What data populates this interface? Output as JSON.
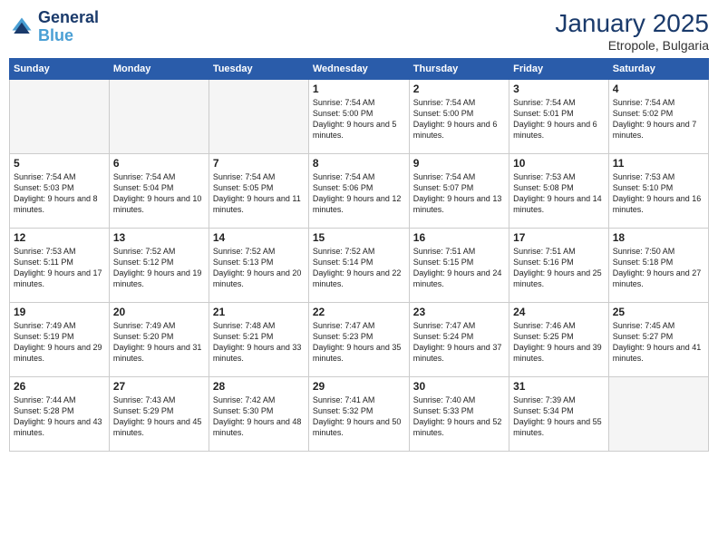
{
  "logo": {
    "line1": "General",
    "line2": "Blue"
  },
  "title": "January 2025",
  "subtitle": "Etropole, Bulgaria",
  "headers": [
    "Sunday",
    "Monday",
    "Tuesday",
    "Wednesday",
    "Thursday",
    "Friday",
    "Saturday"
  ],
  "weeks": [
    [
      {
        "day": "",
        "empty": true
      },
      {
        "day": "",
        "empty": true
      },
      {
        "day": "",
        "empty": true
      },
      {
        "day": "1",
        "sunrise": "7:54 AM",
        "sunset": "5:00 PM",
        "daylight": "9 hours and 5 minutes."
      },
      {
        "day": "2",
        "sunrise": "7:54 AM",
        "sunset": "5:00 PM",
        "daylight": "9 hours and 6 minutes."
      },
      {
        "day": "3",
        "sunrise": "7:54 AM",
        "sunset": "5:01 PM",
        "daylight": "9 hours and 6 minutes."
      },
      {
        "day": "4",
        "sunrise": "7:54 AM",
        "sunset": "5:02 PM",
        "daylight": "9 hours and 7 minutes."
      }
    ],
    [
      {
        "day": "5",
        "sunrise": "7:54 AM",
        "sunset": "5:03 PM",
        "daylight": "9 hours and 8 minutes."
      },
      {
        "day": "6",
        "sunrise": "7:54 AM",
        "sunset": "5:04 PM",
        "daylight": "9 hours and 10 minutes."
      },
      {
        "day": "7",
        "sunrise": "7:54 AM",
        "sunset": "5:05 PM",
        "daylight": "9 hours and 11 minutes."
      },
      {
        "day": "8",
        "sunrise": "7:54 AM",
        "sunset": "5:06 PM",
        "daylight": "9 hours and 12 minutes."
      },
      {
        "day": "9",
        "sunrise": "7:54 AM",
        "sunset": "5:07 PM",
        "daylight": "9 hours and 13 minutes."
      },
      {
        "day": "10",
        "sunrise": "7:53 AM",
        "sunset": "5:08 PM",
        "daylight": "9 hours and 14 minutes."
      },
      {
        "day": "11",
        "sunrise": "7:53 AM",
        "sunset": "5:10 PM",
        "daylight": "9 hours and 16 minutes."
      }
    ],
    [
      {
        "day": "12",
        "sunrise": "7:53 AM",
        "sunset": "5:11 PM",
        "daylight": "9 hours and 17 minutes."
      },
      {
        "day": "13",
        "sunrise": "7:52 AM",
        "sunset": "5:12 PM",
        "daylight": "9 hours and 19 minutes."
      },
      {
        "day": "14",
        "sunrise": "7:52 AM",
        "sunset": "5:13 PM",
        "daylight": "9 hours and 20 minutes."
      },
      {
        "day": "15",
        "sunrise": "7:52 AM",
        "sunset": "5:14 PM",
        "daylight": "9 hours and 22 minutes."
      },
      {
        "day": "16",
        "sunrise": "7:51 AM",
        "sunset": "5:15 PM",
        "daylight": "9 hours and 24 minutes."
      },
      {
        "day": "17",
        "sunrise": "7:51 AM",
        "sunset": "5:16 PM",
        "daylight": "9 hours and 25 minutes."
      },
      {
        "day": "18",
        "sunrise": "7:50 AM",
        "sunset": "5:18 PM",
        "daylight": "9 hours and 27 minutes."
      }
    ],
    [
      {
        "day": "19",
        "sunrise": "7:49 AM",
        "sunset": "5:19 PM",
        "daylight": "9 hours and 29 minutes."
      },
      {
        "day": "20",
        "sunrise": "7:49 AM",
        "sunset": "5:20 PM",
        "daylight": "9 hours and 31 minutes."
      },
      {
        "day": "21",
        "sunrise": "7:48 AM",
        "sunset": "5:21 PM",
        "daylight": "9 hours and 33 minutes."
      },
      {
        "day": "22",
        "sunrise": "7:47 AM",
        "sunset": "5:23 PM",
        "daylight": "9 hours and 35 minutes."
      },
      {
        "day": "23",
        "sunrise": "7:47 AM",
        "sunset": "5:24 PM",
        "daylight": "9 hours and 37 minutes."
      },
      {
        "day": "24",
        "sunrise": "7:46 AM",
        "sunset": "5:25 PM",
        "daylight": "9 hours and 39 minutes."
      },
      {
        "day": "25",
        "sunrise": "7:45 AM",
        "sunset": "5:27 PM",
        "daylight": "9 hours and 41 minutes."
      }
    ],
    [
      {
        "day": "26",
        "sunrise": "7:44 AM",
        "sunset": "5:28 PM",
        "daylight": "9 hours and 43 minutes."
      },
      {
        "day": "27",
        "sunrise": "7:43 AM",
        "sunset": "5:29 PM",
        "daylight": "9 hours and 45 minutes."
      },
      {
        "day": "28",
        "sunrise": "7:42 AM",
        "sunset": "5:30 PM",
        "daylight": "9 hours and 48 minutes."
      },
      {
        "day": "29",
        "sunrise": "7:41 AM",
        "sunset": "5:32 PM",
        "daylight": "9 hours and 50 minutes."
      },
      {
        "day": "30",
        "sunrise": "7:40 AM",
        "sunset": "5:33 PM",
        "daylight": "9 hours and 52 minutes."
      },
      {
        "day": "31",
        "sunrise": "7:39 AM",
        "sunset": "5:34 PM",
        "daylight": "9 hours and 55 minutes."
      },
      {
        "day": "",
        "empty": true
      }
    ]
  ]
}
